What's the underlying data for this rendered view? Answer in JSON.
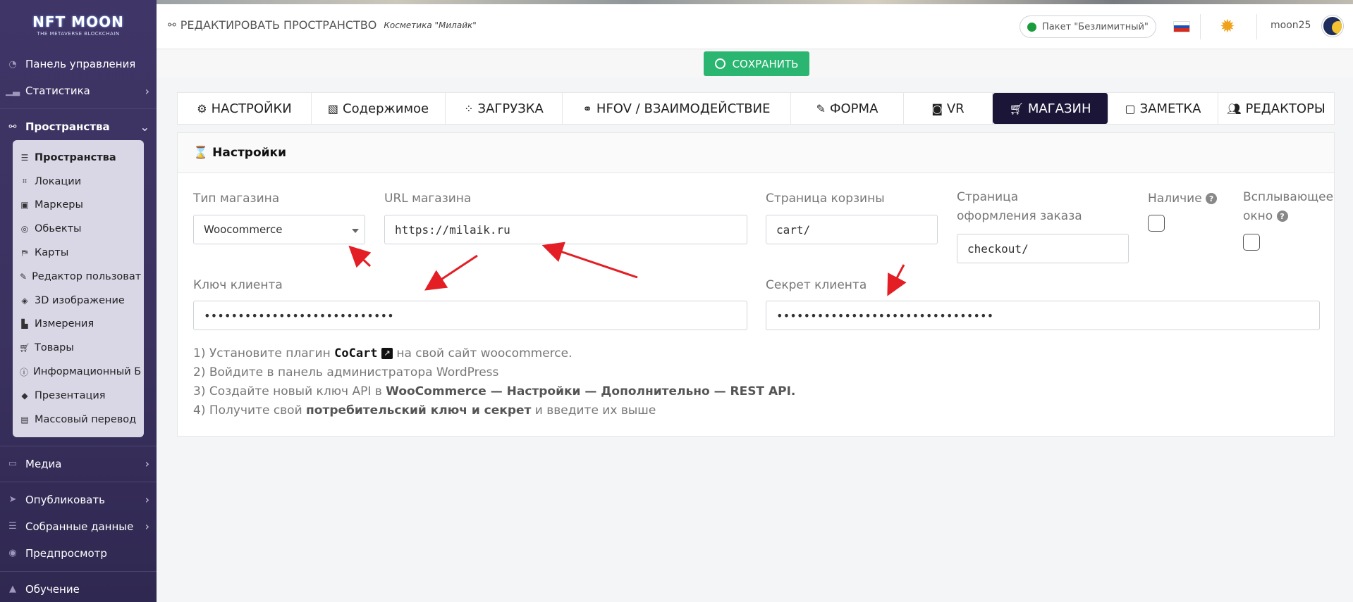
{
  "logo": {
    "main": "NFT MOON",
    "sub": "THE METAVERSE BLOCKCHAIN"
  },
  "sidebar": {
    "dashboard": "Панель управления",
    "statistics": "Статистика",
    "spaces": "Пространства",
    "subitems": [
      {
        "label": "Пространства",
        "icon": "list-icon"
      },
      {
        "label": "Локации",
        "icon": "crop-icon"
      },
      {
        "label": "Маркеры",
        "icon": "image-icon"
      },
      {
        "label": "Обьекты",
        "icon": "bullseye-icon"
      },
      {
        "label": "Карты",
        "icon": "map-icon"
      },
      {
        "label": "Редактор пользоват",
        "icon": "edit-icon"
      },
      {
        "label": "3D изображение",
        "icon": "cube-icon"
      },
      {
        "label": "Измерения",
        "icon": "chart-icon"
      },
      {
        "label": "Товары",
        "icon": "cart-icon"
      },
      {
        "label": "Информационный Б",
        "icon": "info-icon"
      },
      {
        "label": "Презентация",
        "icon": "diamond-icon"
      },
      {
        "label": "Массовый перевод",
        "icon": "translate-icon"
      }
    ],
    "media": "Медиа",
    "publish": "Опубликовать",
    "collected": "Собранные данные",
    "preview": "Предпросмотр",
    "learning": "Обучение"
  },
  "header": {
    "title": "РЕДАКТИРОВАТЬ ПРОСТРАНСТВО",
    "subtitle": "Косметика \"Милайк\"",
    "package": "Пакет \"Безлимитный\"",
    "username": "moon25"
  },
  "save_label": "СОХРАНИТЬ",
  "tabs": [
    {
      "label": "НАСТРОЙКИ",
      "icon": "cogs-icon"
    },
    {
      "label": "Содержимое",
      "icon": "images-icon"
    },
    {
      "label": "ЗАГРУЗКА",
      "icon": "spinner-icon"
    },
    {
      "label": "HFOV / ВЗАИМОДЕЙСТВИЕ",
      "icon": "binoculars-icon"
    },
    {
      "label": "ФОРМА",
      "icon": "form-icon"
    },
    {
      "label": "VR",
      "icon": "vr-icon"
    },
    {
      "label": "МАГАЗИН",
      "icon": "cart-icon",
      "active": true
    },
    {
      "label": "ЗАМЕТКА",
      "icon": "note-icon"
    },
    {
      "label": "РЕДАКТОРЫ",
      "icon": "users-icon"
    }
  ],
  "settings": {
    "heading": "Настройки",
    "shop_type_label": "Тип магазина",
    "shop_type_value": "Woocommerce",
    "shop_url_label": "URL магазина",
    "shop_url_value": "https://milaik.ru",
    "cart_label": "Страница корзины",
    "cart_value": "cart/",
    "checkout_label": "Страница оформления заказа",
    "checkout_value": "checkout/",
    "stock_label": "Наличие",
    "popup_label": "Всплывающее окно",
    "client_key_label": "Ключ клиента",
    "client_key_value": "••••••••••••••••••••••••••••",
    "client_secret_label": "Секрет клиента",
    "client_secret_value": "••••••••••••••••••••••••••••••••"
  },
  "instructions": {
    "l1_a": "1) Установите плагин ",
    "l1_b": "CoCart",
    "l1_c": " на свой сайт woocommerce.",
    "l2": "2) Войдите в панель администратора WordPress",
    "l3_a": "3) Создайте новый ключ API в ",
    "l3_b": "WooCommerce — Настройки — Дополнительно — REST API.",
    "l4_a": "4) Получите свой ",
    "l4_b": "потребительский ключ и секрет",
    "l4_c": " и введите их выше"
  },
  "colors": {
    "accent": "#2ab670",
    "sidebar": "#3f3566",
    "active_tab": "#1b1638",
    "arrow": "#e31e24"
  }
}
